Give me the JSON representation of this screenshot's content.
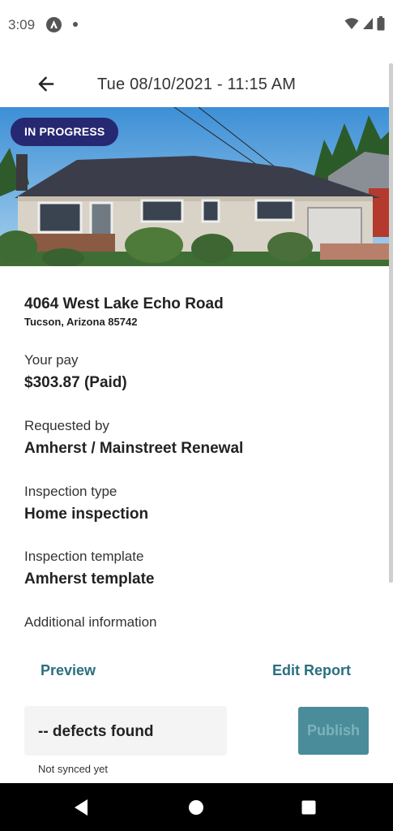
{
  "status_bar": {
    "time": "3:09"
  },
  "header": {
    "title": "Tue 08/10/2021 - 11:15 AM"
  },
  "hero": {
    "status_badge": "IN PROGRESS",
    "badge_color": "#272872"
  },
  "property": {
    "address_line1": "4064 West Lake Echo Road",
    "address_line2": "Tucson, Arizona 85742"
  },
  "details": [
    {
      "label": "Your pay",
      "value": "$303.87 (Paid)"
    },
    {
      "label": "Requested by",
      "value": "Amherst / Mainstreet Renewal"
    },
    {
      "label": "Inspection type",
      "value": "Home inspection"
    },
    {
      "label": "Inspection template",
      "value": "Amherst template"
    },
    {
      "label": "Additional information",
      "value": ""
    }
  ],
  "actions": {
    "preview_label": "Preview",
    "edit_report_label": "Edit Report",
    "accent_color": "#2a6f80"
  },
  "footer": {
    "defects_text": "-- defects found",
    "sync_status": "Not synced yet",
    "publish_label": "Publish",
    "publish_enabled": false
  },
  "icons": {
    "back": "arrow-left-icon",
    "wifi": "wifi-icon",
    "signal": "cell-signal-icon",
    "battery": "battery-icon",
    "nav_back": "triangle-back-icon",
    "nav_home": "circle-home-icon",
    "nav_recents": "square-recents-icon"
  }
}
